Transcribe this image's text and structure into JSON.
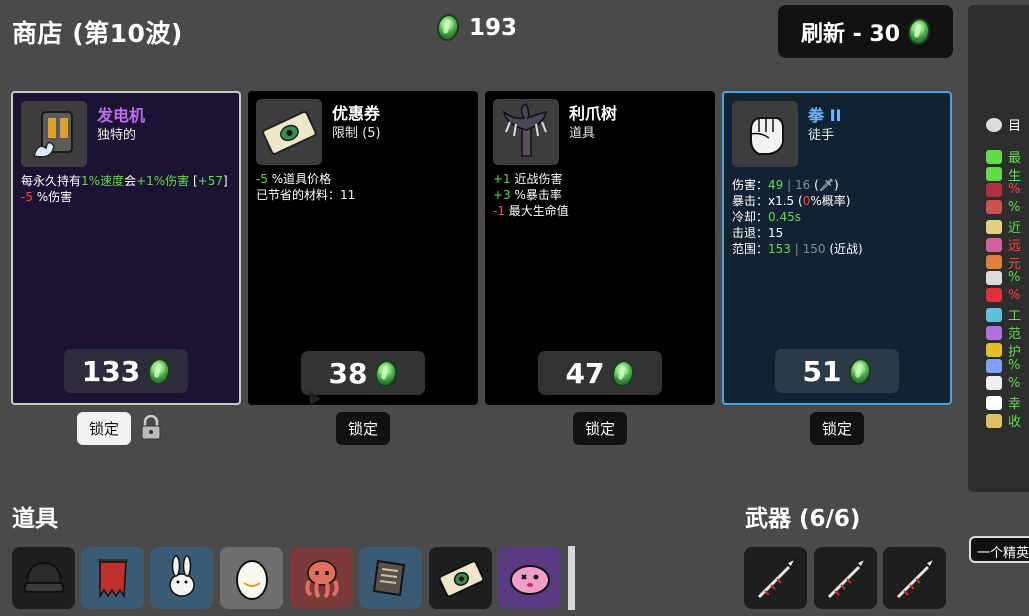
{
  "header": {
    "title": "商店 (第10波)",
    "gold": "193",
    "refresh_label": "刷新 - 30"
  },
  "cards": [
    {
      "name": "发电机",
      "name_color": "#c06cf0",
      "subtitle": "独特的",
      "desc": [
        [
          {
            "t": "每永久持有"
          },
          {
            "t": "1%速度",
            "c": "green"
          },
          {
            "t": "会"
          },
          {
            "t": "+1%伤害",
            "c": "green"
          },
          {
            "t": " ["
          },
          {
            "t": "+57",
            "c": "green"
          },
          {
            "t": "]"
          }
        ],
        [
          {
            "t": "-5",
            "c": "red"
          },
          {
            "t": " %伤害"
          }
        ]
      ],
      "price": "133",
      "lock_label": "锁定",
      "icon": "generator-icon"
    },
    {
      "name": "优惠券",
      "name_color": "#ffffff",
      "subtitle": "限制 (5)",
      "desc": [
        [
          {
            "t": "-5",
            "c": "green"
          },
          {
            "t": " %道具价格"
          }
        ],
        [
          {
            "t": "已节省的材料：11"
          }
        ]
      ],
      "price": "38",
      "lock_label": "锁定",
      "icon": "coupon-icon"
    },
    {
      "name": "利爪树",
      "name_color": "#ffffff",
      "subtitle": "道具",
      "desc": [
        [
          {
            "t": "+1",
            "c": "green"
          },
          {
            "t": " 近战伤害"
          }
        ],
        [
          {
            "t": "+3",
            "c": "green"
          },
          {
            "t": " %暴击率"
          }
        ],
        [
          {
            "t": "-1",
            "c": "red"
          },
          {
            "t": " 最大生命值"
          }
        ]
      ],
      "price": "47",
      "lock_label": "锁定",
      "icon": "claw-tree-icon"
    },
    {
      "name": "拳 II",
      "name_color": "#6fb6ff",
      "subtitle": "徒手",
      "desc": [
        [
          {
            "t": "伤害："
          },
          {
            "t": "49",
            "c": "green"
          },
          {
            "t": " | 16 ",
            "c": "grey"
          },
          {
            "t": "(🗡)"
          }
        ],
        [
          {
            "t": "暴击：x1.5 ("
          },
          {
            "t": "0",
            "c": "red"
          },
          {
            "t": "%概率)"
          }
        ],
        [
          {
            "t": "冷却："
          },
          {
            "t": "0.45s",
            "c": "green"
          }
        ],
        [
          {
            "t": "击退：15"
          }
        ],
        [
          {
            "t": "范围："
          },
          {
            "t": "153",
            "c": "green"
          },
          {
            "t": " | 150 ",
            "c": "grey"
          },
          {
            "t": "(近战)"
          }
        ]
      ],
      "price": "51",
      "lock_label": "锁定",
      "icon": "fist-icon"
    }
  ],
  "items_label": "道具",
  "weapons_label": "武器 (6/6)",
  "items": [
    {
      "icon": "beanie-icon",
      "bg": "dark"
    },
    {
      "icon": "banner-icon",
      "bg": "blue"
    },
    {
      "icon": "rabbit-icon",
      "bg": "blue"
    },
    {
      "icon": "egg-icon",
      "bg": "grey"
    },
    {
      "icon": "octopus-icon",
      "bg": "red"
    },
    {
      "icon": "scroll-icon",
      "bg": "blue"
    },
    {
      "icon": "coupon-icon",
      "bg": "dark"
    },
    {
      "icon": "pink-blob-icon",
      "bg": "purple"
    }
  ],
  "weapons": [
    {
      "icon": "spear-icon"
    },
    {
      "icon": "spear-icon"
    },
    {
      "icon": "spear-icon"
    }
  ],
  "stats_panel": {
    "header_label": "目",
    "rows": [
      {
        "label": "最",
        "color": "#5fde4a",
        "icon_color": "#5fde4a"
      },
      {
        "label": "生",
        "color": "#5fde4a",
        "icon_color": "#5fde4a"
      },
      {
        "label": "%",
        "color": "#ff4040",
        "icon_color": "#b03040"
      },
      {
        "label": "%",
        "color": "#5fde4a",
        "icon_color": "#d05050"
      },
      {
        "label": "近",
        "color": "#5fde4a",
        "icon_color": "#e0d080"
      },
      {
        "label": "远",
        "color": "#ff4040",
        "icon_color": "#d060a0"
      },
      {
        "label": "元",
        "color": "#ff4040",
        "icon_color": "#e08040"
      },
      {
        "label": "%",
        "color": "#5fde4a",
        "icon_color": "#dddddd"
      },
      {
        "label": "%",
        "color": "#ff4040",
        "icon_color": "#e03040"
      },
      {
        "label": "工",
        "color": "#5fde4a",
        "icon_color": "#60c0e0"
      },
      {
        "label": "范",
        "color": "#5fde4a",
        "icon_color": "#b070e0"
      },
      {
        "label": "护",
        "color": "#5fde4a",
        "icon_color": "#e0c020"
      },
      {
        "label": "%",
        "color": "#5fde4a",
        "icon_color": "#80a0ff"
      },
      {
        "label": "%",
        "color": "#5fde4a",
        "icon_color": "#eeeeee"
      },
      {
        "label": "幸",
        "color": "#5fde4a",
        "icon_color": "#ffffff"
      },
      {
        "label": "收",
        "color": "#5fde4a",
        "icon_color": "#e0c060"
      }
    ]
  },
  "elite_tooltip": "一个精英"
}
